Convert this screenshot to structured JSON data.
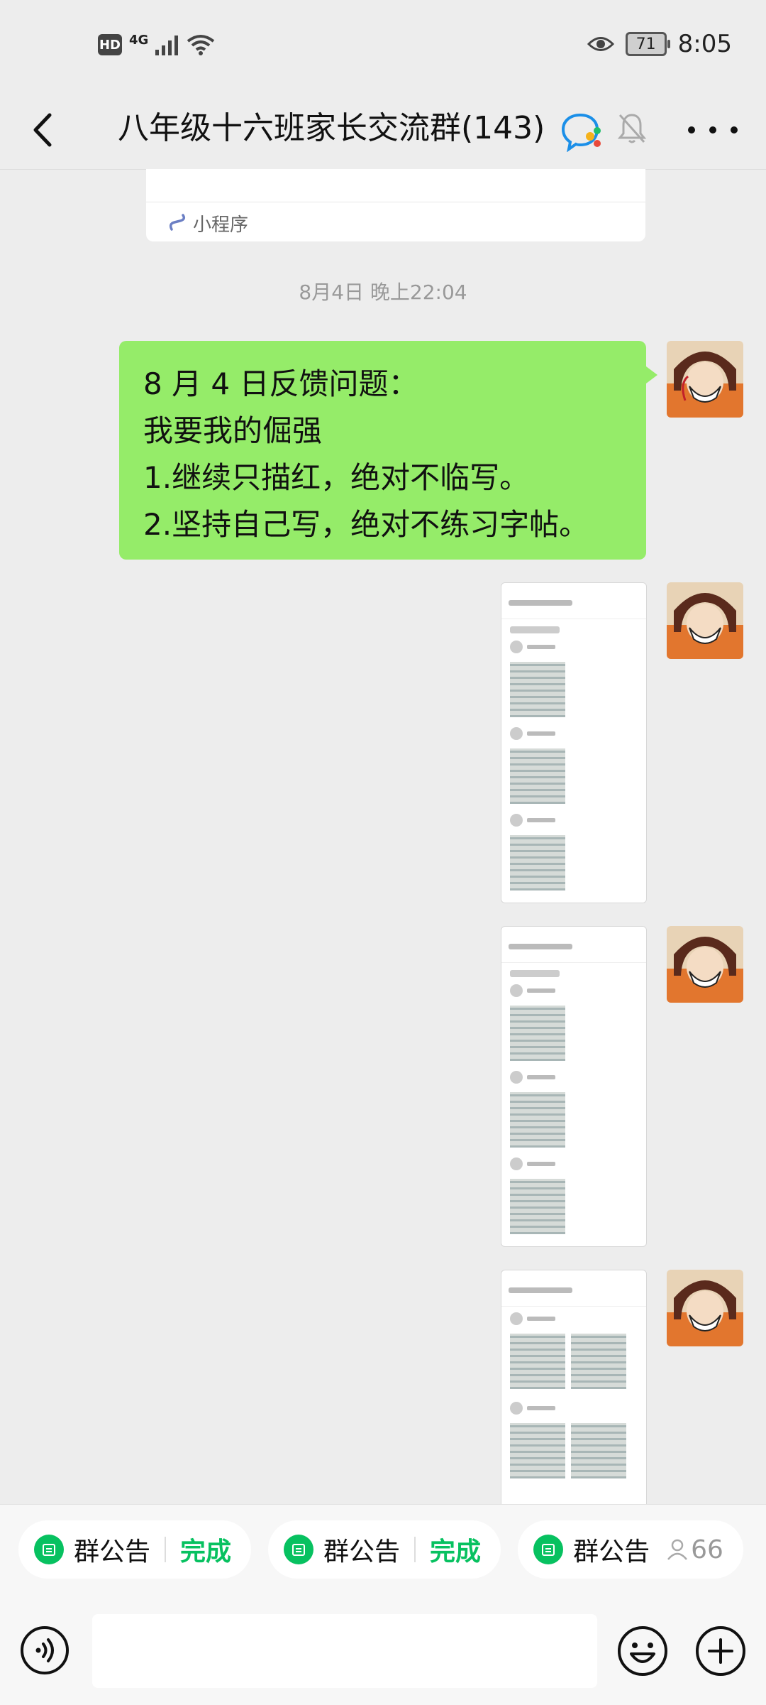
{
  "status_bar": {
    "hd": "HD",
    "network": "4G",
    "battery": "71",
    "time": "8:05"
  },
  "nav": {
    "title": "八年级十六班家长交流群(143)"
  },
  "mini_program": {
    "label": "小程序"
  },
  "timestamp": "8月4日 晚上22:04",
  "message": {
    "lines": [
      "8 月 4 日反馈问题：",
      "我要我的倔强",
      "1.继续只描红，绝对不临写。",
      "2.坚持自己写，绝对不练习字帖。"
    ]
  },
  "announcements": [
    {
      "label": "群公告",
      "status": "完成"
    },
    {
      "label": "群公告",
      "status": "完成"
    },
    {
      "label": "群公告",
      "count": "66"
    }
  ],
  "colors": {
    "bubble": "#95ec69",
    "accent": "#07c160",
    "background": "#ededed"
  }
}
